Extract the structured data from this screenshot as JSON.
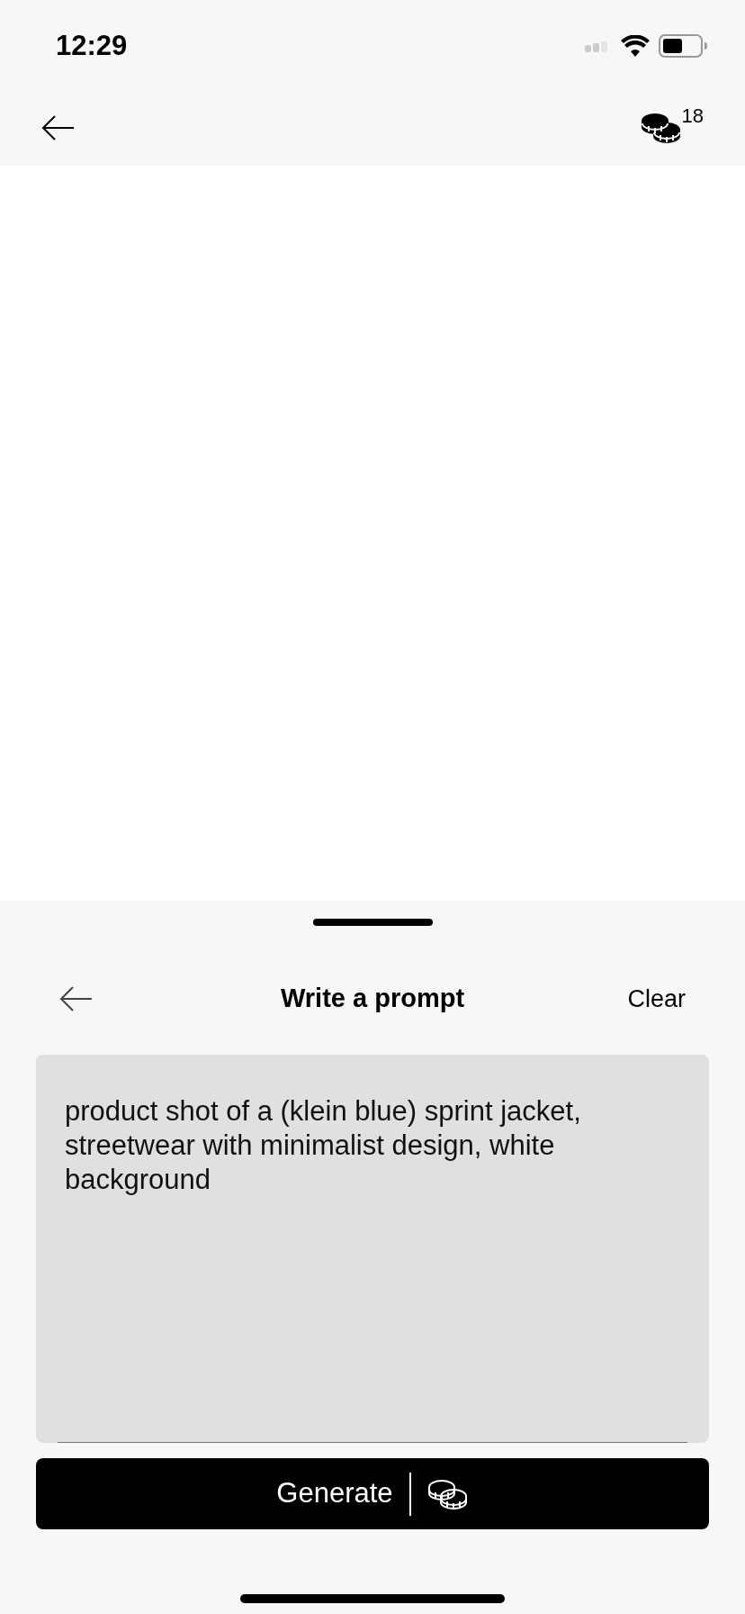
{
  "status_bar": {
    "time": "12:29"
  },
  "nav": {
    "coins": "18"
  },
  "sheet": {
    "title": "Write a prompt",
    "clear": "Clear",
    "prompt": {
      "value": "product shot of a (klein blue) sprint jacket, streetwear with minimalist design, white background"
    },
    "generate": "Generate"
  }
}
